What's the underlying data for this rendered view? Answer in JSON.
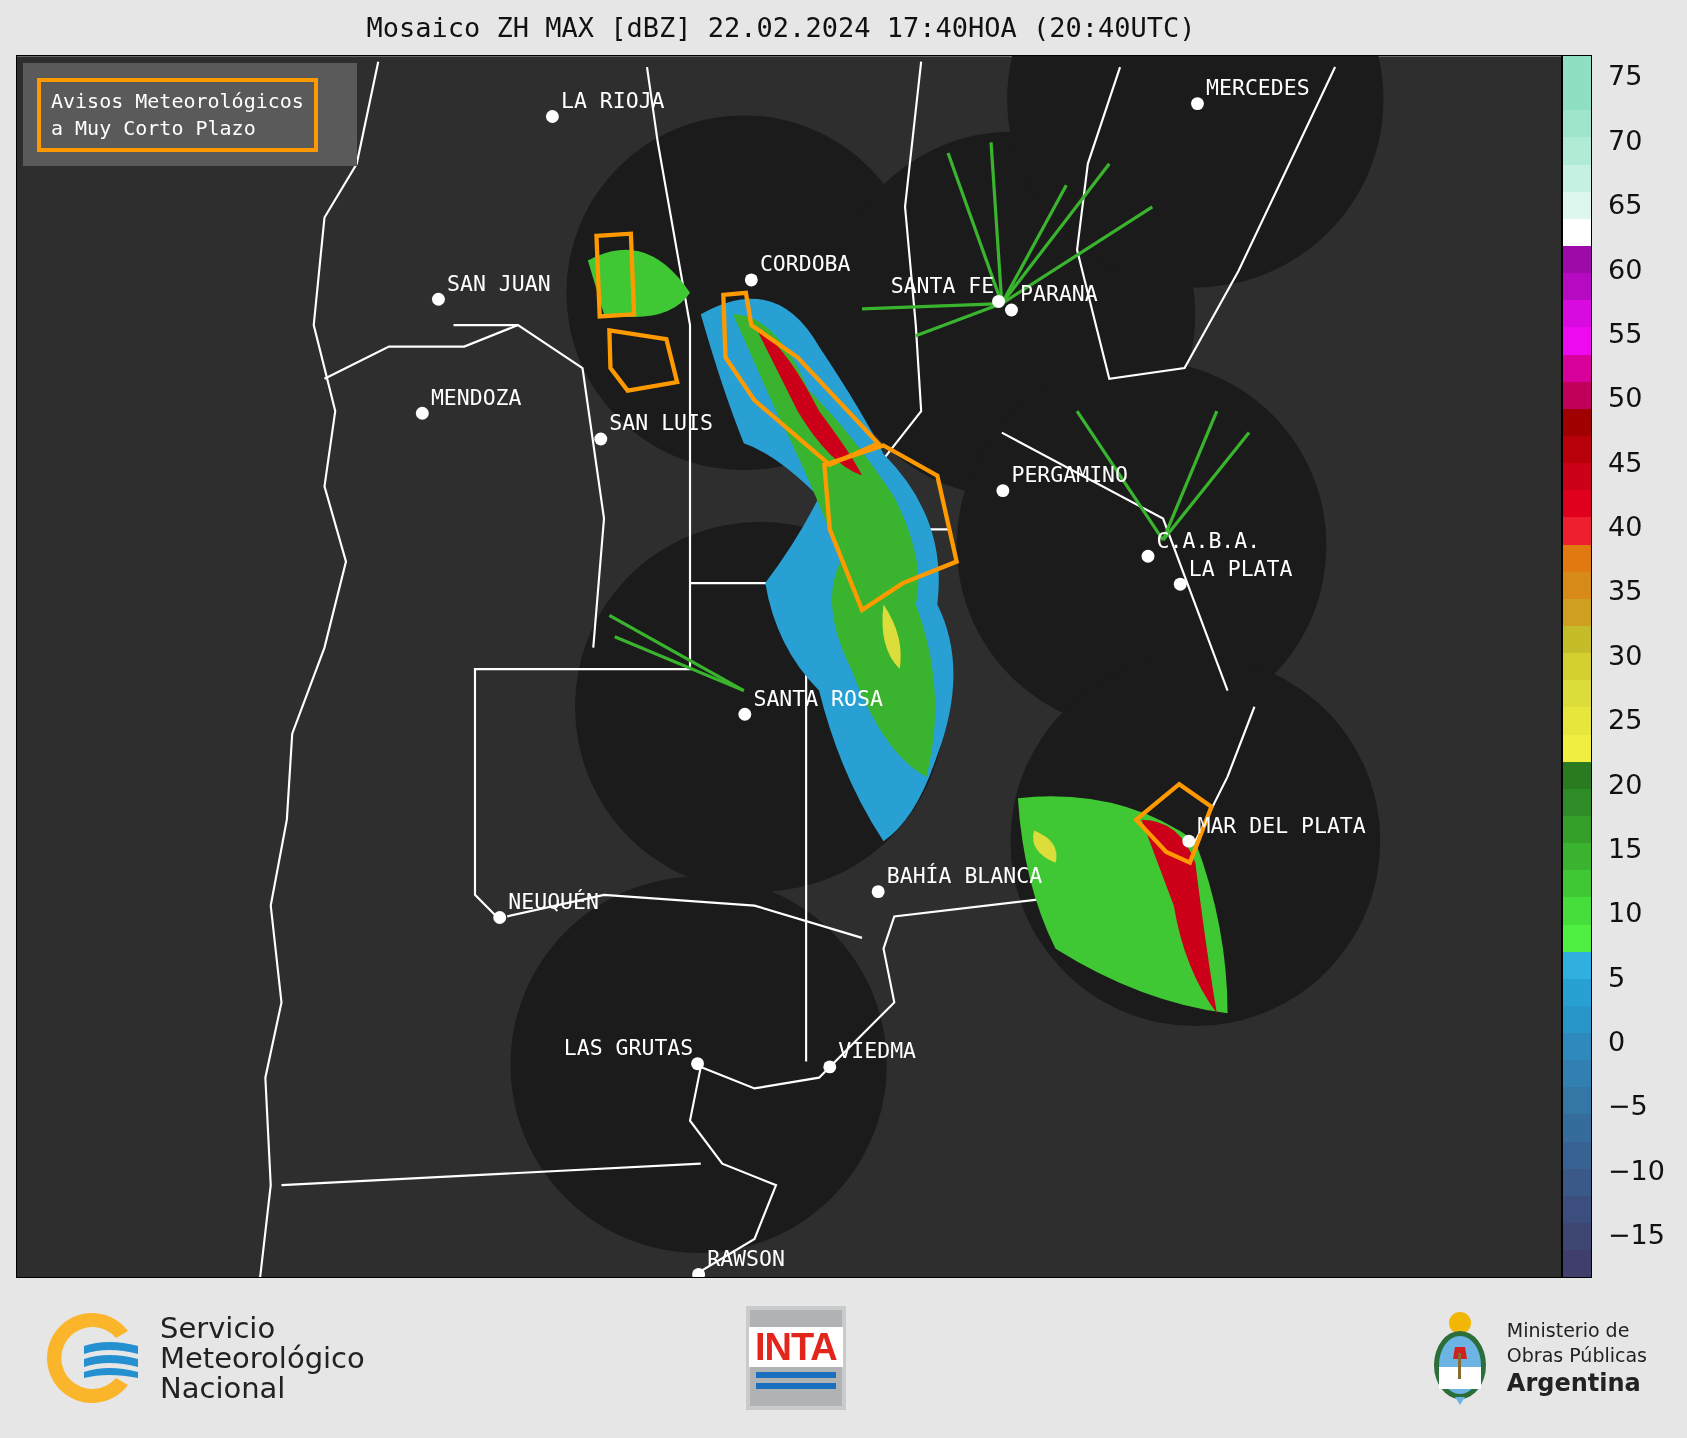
{
  "title": "Mosaico ZH MAX [dBZ] 22.02.2024 17:40HOA (20:40UTC)",
  "legend": {
    "label": "Avisos Meteorológicos\na Muy Corto Plazo"
  },
  "cities": [
    "LA RIOJA",
    "MERCEDES",
    "SAN JUAN",
    "CORDOBA",
    "SANTA FE",
    "PARANA",
    "MENDOZA",
    "SAN LUIS",
    "PERGAMINO",
    "C.A.B.A.",
    "LA PLATA",
    "SANTA ROSA",
    "MAR DEL PLATA",
    "BAHÍA BLANCA",
    "NEUQUÉN",
    "LAS GRUTAS",
    "VIEDMA",
    "RAWSON"
  ],
  "colorbar": {
    "ticks": [
      "75",
      "70",
      "65",
      "60",
      "55",
      "50",
      "45",
      "40",
      "35",
      "30",
      "25",
      "20",
      "15",
      "10",
      "5",
      "0",
      "−5",
      "−10",
      "−15"
    ]
  },
  "footer": {
    "smn": "Servicio\nMeteorológico\nNacional",
    "inta": "INTA",
    "ministry": [
      "Ministerio de",
      "Obras Públicas",
      "Argentina"
    ]
  }
}
